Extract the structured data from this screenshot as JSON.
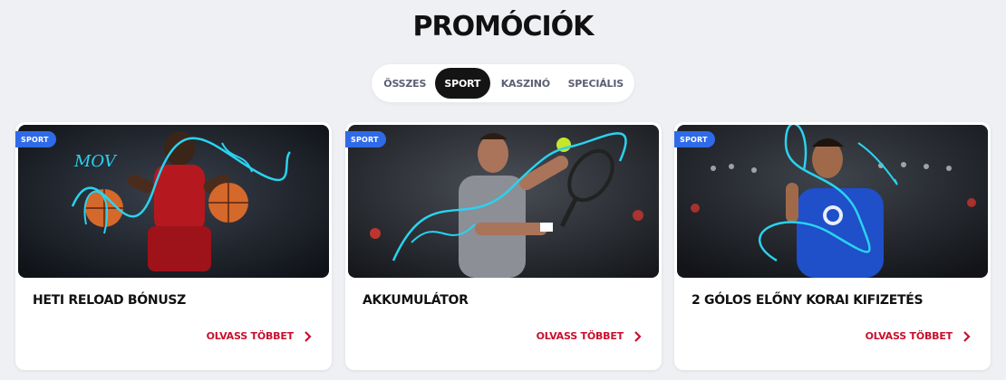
{
  "page": {
    "title": "PROMÓCIÓK"
  },
  "tabs": [
    {
      "label": "ÖSSZES",
      "active": false
    },
    {
      "label": "SPORT",
      "active": true
    },
    {
      "label": "KASZINÓ",
      "active": false
    },
    {
      "label": "SPECIÁLIS",
      "active": false
    }
  ],
  "cards": [
    {
      "badge": "SPORT",
      "title": "HETI RELOAD BÓNUSZ",
      "cta": "OLVASS TÖBBET",
      "art_text": "MOV"
    },
    {
      "badge": "SPORT",
      "title": "AKKUMULÁTOR",
      "cta": "OLVASS TÖBBET"
    },
    {
      "badge": "SPORT",
      "title": "2 GÓLOS ELŐNY KORAI KIFIZETÉS",
      "cta": "OLVASS TÖBBET"
    }
  ],
  "colors": {
    "background": "#eef0f3",
    "badge": "#2f6ae8",
    "cta": "#c8102e",
    "active_tab": "#141414",
    "swirl": "#29d3f0"
  },
  "icons": {
    "cta": "chevron-right-icon"
  }
}
